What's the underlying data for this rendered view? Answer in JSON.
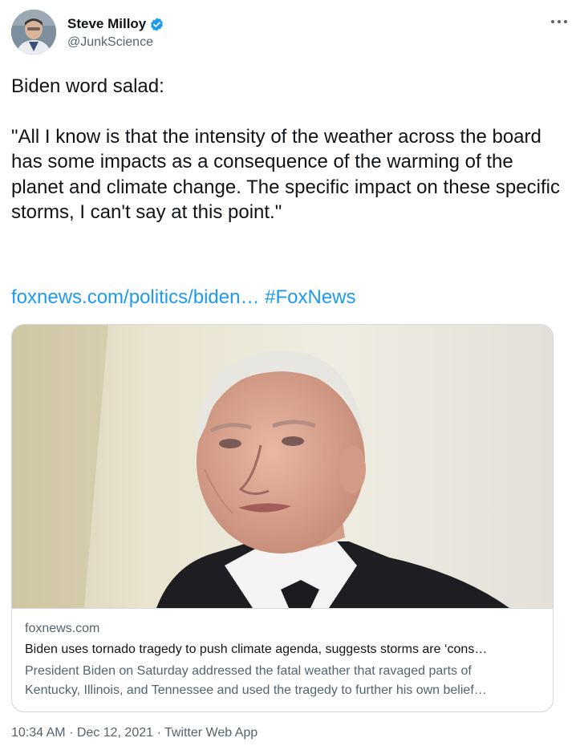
{
  "author": {
    "display_name": "Steve Milloy",
    "handle": "@JunkScience",
    "verified": true
  },
  "more_icon": "more-horizontal-icon",
  "tweet": {
    "intro": "Biden word salad:",
    "quote": "\"All I know is that the intensity of the weather across the board has some impacts as a consequence of the warming of the planet and climate change. The specific impact on these specific storms, I can't say at this point.\"",
    "link": "foxnews.com/politics/biden…",
    "hashtag": "#FoxNews"
  },
  "card": {
    "domain": "foxnews.com",
    "title": "Biden uses tornado tragedy to push climate agenda, suggests storms are ‘cons…",
    "description_line1": "President Biden on Saturday addressed the fatal weather that ravaged parts of",
    "description_line2": "Kentucky, Illinois, and Tennessee and used the tragedy to further his own belief…"
  },
  "meta": {
    "time": "10:34 AM",
    "date": "Dec 12, 2021",
    "source": "Twitter Web App",
    "separator": "·"
  },
  "colors": {
    "link": "#1d9bf0",
    "secondary_text": "#536471",
    "primary_text": "#0f1419",
    "border": "#cfd9de"
  }
}
